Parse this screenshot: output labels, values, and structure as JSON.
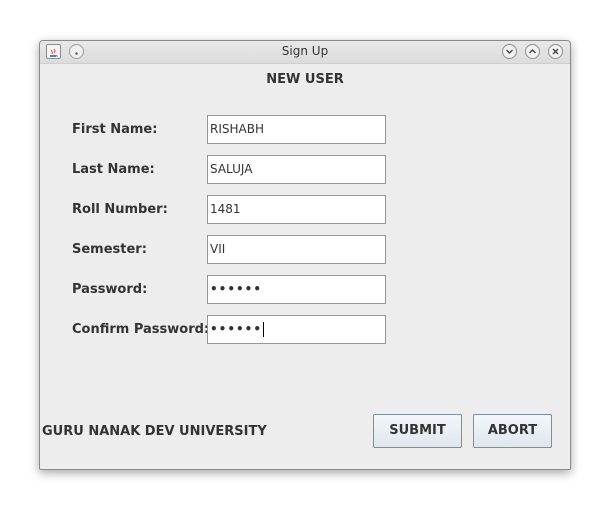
{
  "window": {
    "title": "Sign Up",
    "icons": [
      "java-icon",
      "menu-dot-icon"
    ],
    "controls": [
      "minimize-icon",
      "maximize-icon",
      "close-icon"
    ]
  },
  "form": {
    "heading": "NEW USER",
    "fields": [
      {
        "label": "First Name:",
        "value": "RISHABH"
      },
      {
        "label": "Last Name:",
        "value": "SALUJA"
      },
      {
        "label": "Roll Number:",
        "value": "1481"
      },
      {
        "label": "Semester:",
        "value": "VII"
      },
      {
        "label": "Password:",
        "value": "••••••"
      },
      {
        "label": "Confirm Password:",
        "value": "••••••"
      }
    ]
  },
  "footer": {
    "university": "GURU NANAK DEV UNIVERSITY",
    "submit_label": "SUBMIT",
    "abort_label": "ABORT"
  }
}
